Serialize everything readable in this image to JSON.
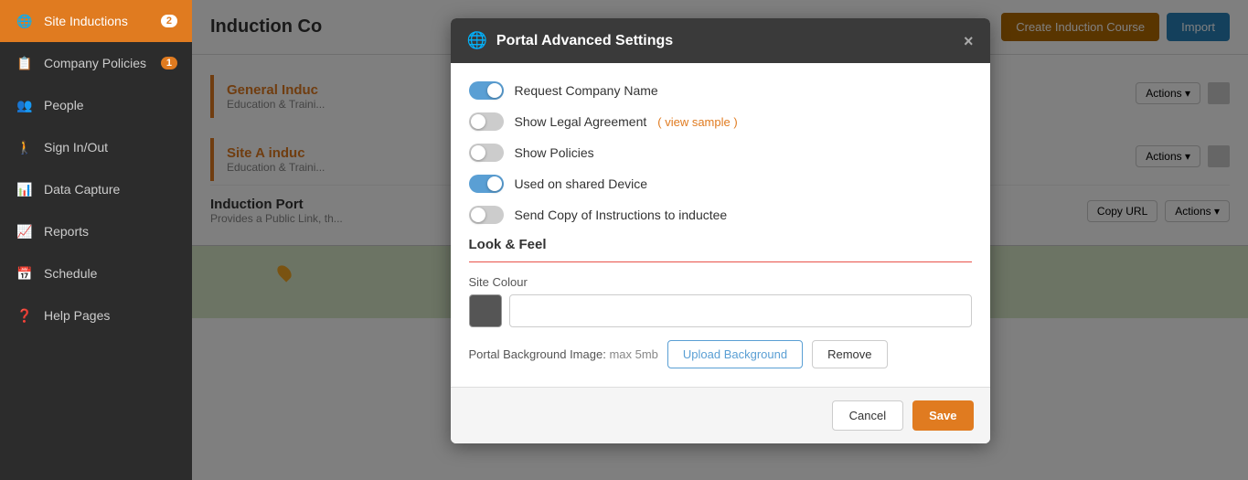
{
  "sidebar": {
    "items": [
      {
        "id": "site-inductions",
        "label": "Site Inductions",
        "badge": "2",
        "active": true
      },
      {
        "id": "company-policies",
        "label": "Company Policies",
        "badge": "1",
        "active": false
      },
      {
        "id": "people",
        "label": "People",
        "badge": "",
        "active": false
      },
      {
        "id": "sign-in-out",
        "label": "Sign In/Out",
        "badge": "",
        "active": false
      },
      {
        "id": "data-capture",
        "label": "Data Capture",
        "badge": "",
        "active": false
      },
      {
        "id": "reports",
        "label": "Reports",
        "badge": "",
        "active": false
      },
      {
        "id": "schedule",
        "label": "Schedule",
        "badge": "",
        "active": false
      },
      {
        "id": "help-pages",
        "label": "Help Pages",
        "badge": "",
        "active": false
      }
    ]
  },
  "main": {
    "title": "Induction Co",
    "create_button": "Create Induction Course",
    "import_button": "Import",
    "sections": [
      {
        "title": "General Induc",
        "sub": "Education & Traini..."
      },
      {
        "title": "Site A induc",
        "sub": "Education & Traini..."
      }
    ],
    "portal": {
      "title": "Induction Port",
      "sub": "Provides a Public Link, th..."
    },
    "actions_label": "Actions ▾",
    "copy_url_label": "Copy URL",
    "actions2_label": "Actions ▾"
  },
  "modal": {
    "title": "Portal Advanced Settings",
    "close_label": "×",
    "globe_icon": "🌐",
    "toggles": [
      {
        "id": "request-company-name",
        "label": "Request Company Name",
        "on": true
      },
      {
        "id": "show-legal-agreement",
        "label": "Show Legal Agreement",
        "on": false,
        "extra": "( view sample )"
      },
      {
        "id": "show-policies",
        "label": "Show Policies",
        "on": false
      },
      {
        "id": "used-on-shared-device",
        "label": "Used on shared Device",
        "on": true
      },
      {
        "id": "send-copy",
        "label": "Send Copy of Instructions to inductee",
        "on": false
      }
    ],
    "look_feel": {
      "title": "Look & Feel",
      "site_colour_label": "Site Colour",
      "colour_hex": "",
      "colour_swatch_bg": "#555555",
      "bg_image_label": "Portal Background Image:",
      "bg_image_max": "max 5mb",
      "upload_button": "Upload Background",
      "remove_button": "Remove"
    },
    "footer": {
      "cancel_label": "Cancel",
      "save_label": "Save"
    }
  }
}
